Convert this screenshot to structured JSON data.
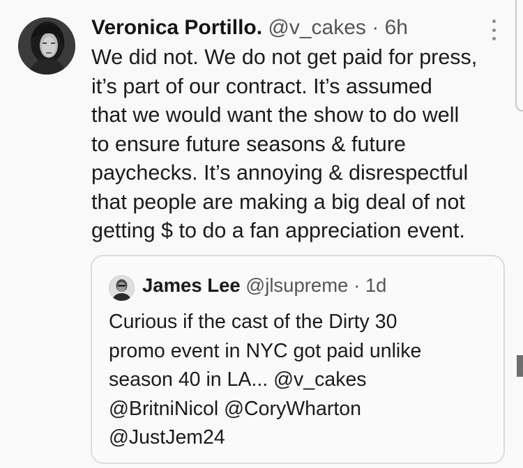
{
  "tweet": {
    "author": {
      "display_name": "Veronica Portillo.",
      "handle": "@v_cakes",
      "separator": "·",
      "time": "6h"
    },
    "more_icon": "vertical-ellipsis-icon",
    "body_lines": [
      "We did not. We do not get paid for press,",
      "it’s part of our contract.  It’s assumed",
      "that we would want the show to do well",
      "to ensure future seasons & future",
      "paychecks. It’s annoying & disrespectful",
      "that people are making a big deal of not",
      "getting $ to do a fan appreciation event."
    ]
  },
  "quoted_tweet": {
    "author": {
      "display_name": "James Lee",
      "handle": "@jlsupreme",
      "separator": "·",
      "time": "1d"
    },
    "body_lines": [
      "Curious if the cast of the Dirty 30",
      "promo event in NYC got paid unlike",
      "season 40 in LA... @v_cakes",
      "@BritniNicol @CoryWharton",
      "@JustJem24"
    ]
  },
  "colors": {
    "background": "#f9f9f9",
    "text": "#1b1b1b",
    "secondary_text": "#555555",
    "quote_border": "#dcdcdc"
  }
}
